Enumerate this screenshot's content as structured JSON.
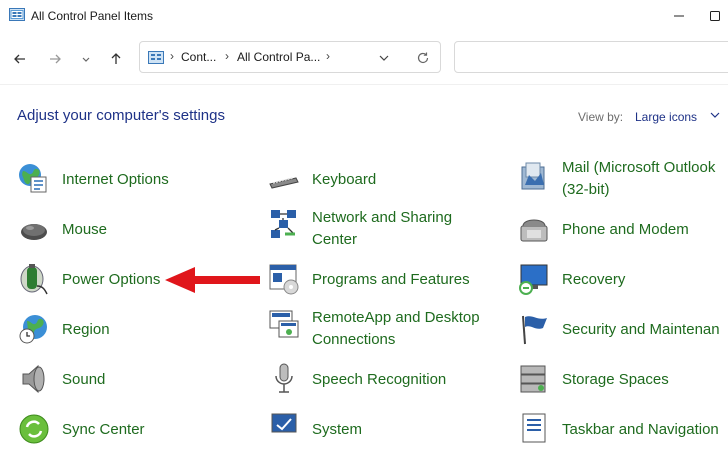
{
  "window": {
    "title": "All Control Panel Items"
  },
  "address": {
    "crumbs": [
      "Cont...",
      "All Control Pa..."
    ]
  },
  "search": {
    "placeholder": ""
  },
  "main": {
    "heading": "Adjust your computer's settings",
    "view_by_label": "View by:",
    "view_by_value": "Large icons"
  },
  "items": {
    "internet_options": "Internet Options",
    "keyboard": "Keyboard",
    "mail_1": "Mail (Microsoft Outlook",
    "mail_2": "(32-bit)",
    "mouse": "Mouse",
    "network_1": "Network and Sharing",
    "network_2": "Center",
    "phone": "Phone and Modem",
    "power": "Power Options",
    "programs": "Programs and Features",
    "recovery": "Recovery",
    "region": "Region",
    "remoteapp_1": "RemoteApp and Desktop",
    "remoteapp_2": "Connections",
    "security": "Security and Maintenan",
    "sound": "Sound",
    "speech": "Speech Recognition",
    "storage": "Storage Spaces",
    "sync": "Sync Center",
    "system": "System",
    "taskbar": "Taskbar and Navigation"
  },
  "colors": {
    "link_green": "#1e6b1e",
    "heading_blue": "#1e3287",
    "arrow_red": "#e0161b"
  }
}
